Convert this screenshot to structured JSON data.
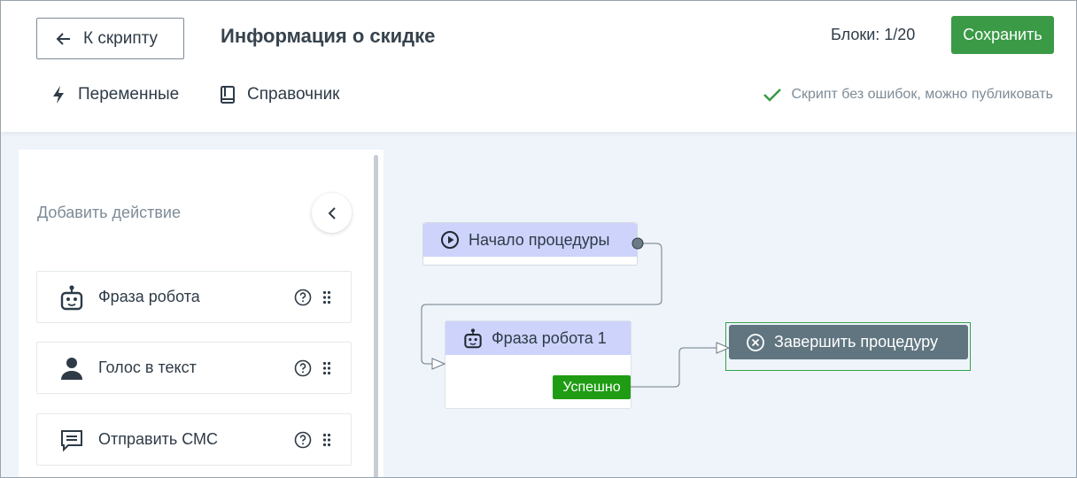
{
  "header": {
    "back_label": "К скрипту",
    "title": "Информация о скидке",
    "blocks_counter": "Блоки: 1/20",
    "save_label": "Сохранить"
  },
  "toolbar": {
    "variables_label": "Переменные",
    "reference_label": "Справочник",
    "status_text": "Скрипт без ошибок, можно публиковать"
  },
  "sidebar": {
    "title": "Добавить действие",
    "actions": [
      {
        "label": "Фраза робота",
        "icon": "robot-icon"
      },
      {
        "label": "Голос в текст",
        "icon": "person-icon"
      },
      {
        "label": "Отправить СМС",
        "icon": "message-icon"
      }
    ]
  },
  "flow": {
    "start_node": "Начало процедуры",
    "robot_node": "Фраза робота 1",
    "robot_output": "Успешно",
    "end_node": "Завершить процедуру"
  },
  "colors": {
    "primary_green": "#3a9a46",
    "success_tag": "#1f9c14",
    "node_header": "#cdd3fb",
    "end_node": "#607580",
    "canvas_bg": "#eef4fa"
  }
}
